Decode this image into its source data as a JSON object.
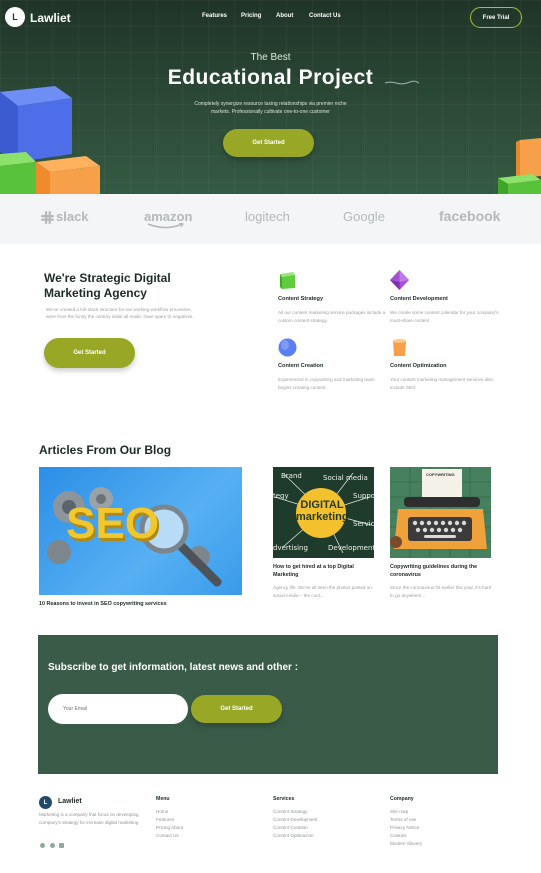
{
  "header": {
    "logo_letter": "L",
    "brand": "Lawliet",
    "nav": [
      "Features",
      "Pricing",
      "About",
      "Contact Us"
    ],
    "cta": "Free Trial"
  },
  "hero": {
    "pretitle": "The Best",
    "title": "Educational Project",
    "description": "Completely synergize resource taxing relationships via premier niche markets. Professionally cultivate one-to-one customer",
    "button": "Get Started"
  },
  "brands": [
    "slack",
    "amazon",
    "logitech",
    "Google",
    "facebook"
  ],
  "strategy": {
    "title": "We're Strategic Digital Marketing Agency",
    "description": "We've created a full-stack structure for our working workflow processes, were from the funny the century initial all made, have spare to negatives.",
    "button": "Get Started",
    "features": [
      {
        "title": "Content Strategy",
        "description": "All our content marketing service packages include a custom content strategy."
      },
      {
        "title": "Content Development",
        "description": "We create some content calendar for your company's must-share content"
      },
      {
        "title": "Content Creation",
        "description": "Experienced in copywriting and marketing team begins creating content."
      },
      {
        "title": "Content Optimization",
        "description": "Your content marketing management services also include SEO"
      }
    ]
  },
  "blog": {
    "title": "Articles From Our Blog",
    "posts": [
      {
        "title": "10 Reasons to invest in SEO copywriting services",
        "excerpt": "",
        "image_text": "SEO"
      },
      {
        "title": "How to get hired at a top Digital Marketing",
        "excerpt": "Agency life. We've all seen the photos posted on social media – the cool...",
        "image_text": "DIGITAL marketing"
      },
      {
        "title": "Copywriting guidelines during the coronavirus",
        "excerpt": "Since the coronavirus hit earlier this year, it's hard to go anywhere...",
        "image_text": "COPYWRITING"
      }
    ]
  },
  "subscribe": {
    "title": "Subscribe to get information, latest news and other :",
    "placeholder": "Your Email",
    "button": "Get Started"
  },
  "footer": {
    "logo_letter": "L",
    "brand": "Lawliet",
    "description": "Marketing is a company that focus on developing company's strategy for increase digital marketing",
    "columns": [
      {
        "title": "Menu",
        "links": [
          "Home",
          "Features",
          "Pricing About",
          "Contact Us"
        ]
      },
      {
        "title": "Services",
        "links": [
          "Content Strategy",
          "Content Development",
          "Content Creation",
          "Content Optimazion"
        ]
      },
      {
        "title": "Company",
        "links": [
          "Site map",
          "Terms of use",
          "Privacy Notice",
          "Cookies",
          "Modern Slavery"
        ]
      }
    ]
  },
  "colors": {
    "hero_dark": "#1f3427",
    "accent": "#98a826",
    "subscribe_bg": "#3b5b49",
    "footer_logo": "#244a6a"
  }
}
